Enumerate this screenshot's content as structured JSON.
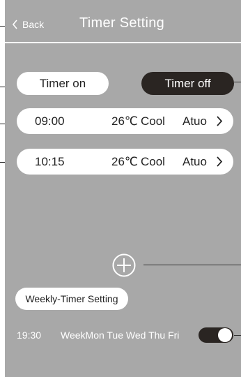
{
  "header": {
    "back_label": "Back",
    "title": "Timer Setting"
  },
  "tabs": {
    "timer_on": "Timer on",
    "timer_off": "Timer off",
    "active": "timer_off"
  },
  "timers": [
    {
      "time": "09:00",
      "temp": "26℃",
      "mode": "Cool",
      "fan": "Atuo"
    },
    {
      "time": "10:15",
      "temp": "26℃",
      "mode": "Cool",
      "fan": "Atuo"
    }
  ],
  "add_icon": "plus-circle-icon",
  "weekly": {
    "button_label": "Weekly-Timer Setting",
    "time": "19:30",
    "days": "WeekMon Tue Wed Thu Fri",
    "enabled": true
  },
  "colors": {
    "screen_bg": "#a8a8a8",
    "dark": "#2a2522",
    "light": "#ffffff"
  }
}
